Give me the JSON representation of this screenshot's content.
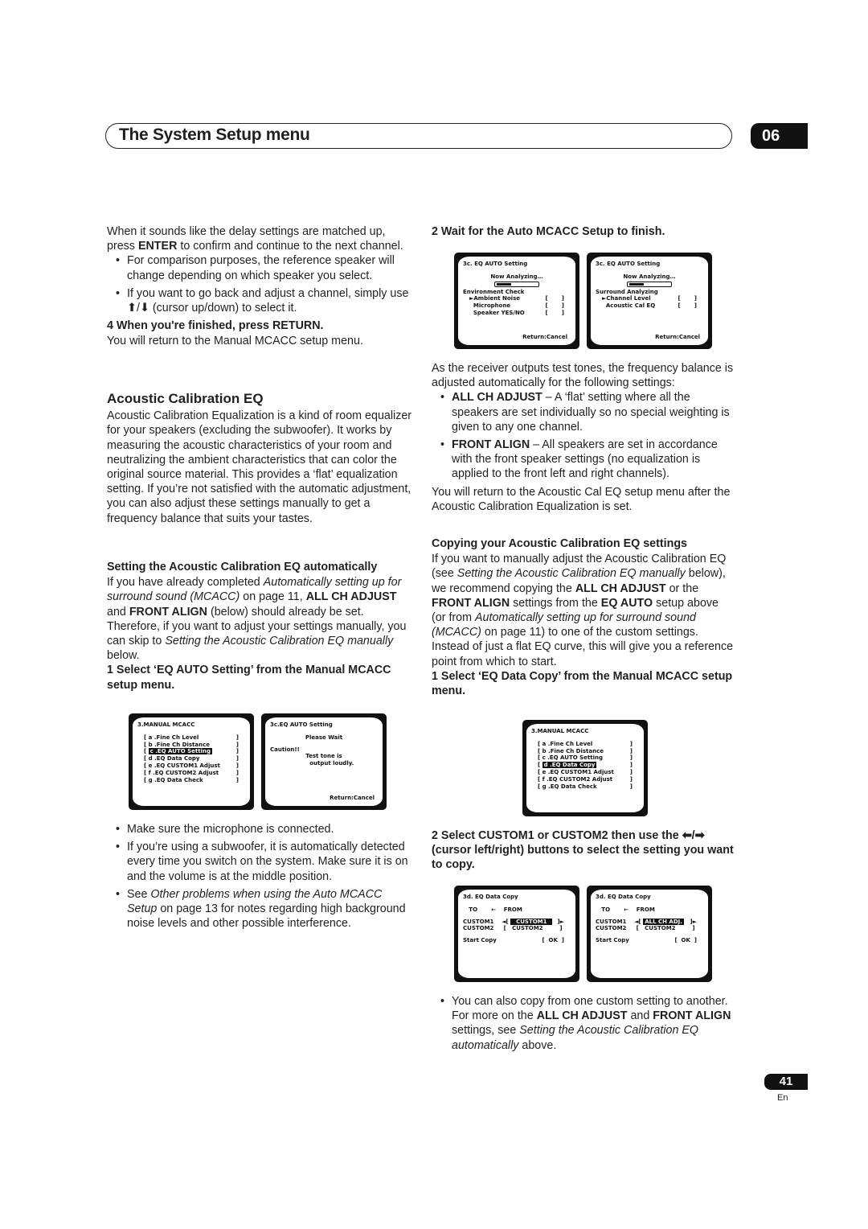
{
  "header": {
    "title": "The System Setup menu",
    "chapter": "06"
  },
  "footer": {
    "page": "41",
    "lang": "En"
  },
  "left": {
    "intro": [
      {
        "type": "p",
        "segs": [
          [
            "When it sounds like the delay settings are matched up, press ",
            ""
          ],
          [
            "ENTER",
            "b"
          ],
          [
            " to confirm and continue to the next channel.",
            ""
          ]
        ]
      },
      {
        "type": "bul",
        "segs": [
          [
            "For comparison purposes, the reference speaker will change depending on which speaker you select.",
            ""
          ]
        ]
      },
      {
        "type": "bul",
        "segs": [
          [
            "If you want to go back and adjust a channel, simply use ⬆/⬇ (cursor up/down) to select it.",
            ""
          ]
        ]
      },
      {
        "type": "step",
        "segs": [
          [
            "4   When you're finished, press RETURN.",
            ""
          ]
        ]
      },
      {
        "type": "p",
        "segs": [
          [
            "You will return to the Manual MCACC setup menu.",
            ""
          ]
        ]
      }
    ],
    "section": [
      {
        "type": "h2",
        "segs": [
          [
            "Acoustic Calibration EQ",
            ""
          ]
        ]
      },
      {
        "type": "p",
        "segs": [
          [
            "Acoustic Calibration Equalization is a kind of room equalizer for your speakers (excluding the subwoofer). It works by measuring the acoustic characteristics of your room and neutralizing the ambient characteristics that can color the original source material. This provides a ‘flat’ equalization setting. If you’re not satisfied with the automatic adjustment, you can also adjust these settings manually to get a frequency balance that suits your tastes.",
            ""
          ]
        ]
      }
    ],
    "auto": [
      {
        "type": "h3",
        "segs": [
          [
            "Setting the Acoustic Calibration EQ automatically",
            ""
          ]
        ]
      },
      {
        "type": "p",
        "segs": [
          [
            "If you have already completed ",
            ""
          ],
          [
            "Automatically setting up for surround sound (MCACC)",
            "i"
          ],
          [
            " on page 11, ",
            ""
          ],
          [
            "ALL CH ADJUST",
            "b"
          ],
          [
            " and ",
            ""
          ],
          [
            "FRONT ALIGN",
            "b"
          ],
          [
            " (below) should already be set. Therefore, if you want to adjust your settings manually, you can skip to ",
            ""
          ],
          [
            "Setting the Acoustic Calibration EQ manually",
            "i"
          ],
          [
            " below.",
            ""
          ]
        ]
      },
      {
        "type": "step",
        "segs": [
          [
            "1   Select ‘EQ AUTO Setting’ from the Manual MCACC setup menu.",
            ""
          ]
        ]
      }
    ],
    "after": [
      {
        "type": "bul",
        "segs": [
          [
            "Make sure the microphone is connected.",
            ""
          ]
        ]
      },
      {
        "type": "bul",
        "segs": [
          [
            "If you’re using a subwoofer, it is automatically detected every time you switch on the system. Make sure it is on and the volume is at the middle position.",
            ""
          ]
        ]
      },
      {
        "type": "bul",
        "segs": [
          [
            "See ",
            ""
          ],
          [
            "Other problems when using the Auto MCACC Setup",
            "i"
          ],
          [
            " on page 13 for notes regarding high background noise levels and other possible interference.",
            ""
          ]
        ]
      }
    ]
  },
  "right": {
    "wait": [
      {
        "type": "step",
        "segs": [
          [
            "2   Wait for the Auto MCACC Setup to finish.",
            ""
          ]
        ]
      }
    ],
    "settings": [
      {
        "type": "p",
        "segs": [
          [
            "As the receiver outputs test tones, the frequency balance is adjusted automatically for the following settings:",
            ""
          ]
        ]
      },
      {
        "type": "bul",
        "segs": [
          [
            "ALL CH ADJUST",
            "b"
          ],
          [
            " – A ‘flat’ setting where all the speakers are set individually so no special weighting is given to any one channel.",
            ""
          ]
        ]
      },
      {
        "type": "bul",
        "segs": [
          [
            "FRONT ALIGN",
            "b"
          ],
          [
            " – All speakers are set in accordance with the front speaker settings (no equalization is applied to the front left and right channels).",
            ""
          ]
        ]
      },
      {
        "type": "p",
        "segs": [
          [
            "You will return to the Acoustic Cal EQ setup menu after the Acoustic Calibration Equalization is set.",
            ""
          ]
        ]
      }
    ],
    "copy": [
      {
        "type": "h3",
        "segs": [
          [
            "Copying your Acoustic Calibration EQ settings",
            ""
          ]
        ]
      },
      {
        "type": "p",
        "segs": [
          [
            "If you want to manually adjust the Acoustic Calibration EQ (see ",
            ""
          ],
          [
            "Setting the Acoustic Calibration EQ manually",
            "i"
          ],
          [
            " below), we recommend copying the ",
            ""
          ],
          [
            "ALL CH ADJUST",
            "b"
          ],
          [
            " or the ",
            ""
          ],
          [
            "FRONT ALIGN",
            "b"
          ],
          [
            " settings from the ",
            ""
          ],
          [
            "EQ AUTO",
            "b"
          ],
          [
            " setup above (or from ",
            ""
          ],
          [
            "Automatically setting up for surround sound (MCACC)",
            "i"
          ],
          [
            " on page 11) to one of the custom settings. Instead of just a flat EQ curve, this will give you a reference point from which to start.",
            ""
          ]
        ]
      },
      {
        "type": "step",
        "segs": [
          [
            "1   Select ‘EQ Data Copy’ from the Manual MCACC setup menu.",
            ""
          ]
        ]
      }
    ],
    "select": [
      {
        "type": "step",
        "segs": [
          [
            "2   Select CUSTOM1 or CUSTOM2 then use the ⬅/➡ (cursor left/right) buttons to select the setting you want to copy.",
            ""
          ]
        ]
      }
    ],
    "last": [
      {
        "type": "bul",
        "segs": [
          [
            "You can also copy from one custom setting to another. For more on the ",
            ""
          ],
          [
            "ALL CH ADJUST",
            "b"
          ],
          [
            " and ",
            ""
          ],
          [
            "FRONT ALIGN",
            "b"
          ],
          [
            " settings, see ",
            ""
          ],
          [
            "Setting the Acoustic Calibration EQ automatically",
            "i"
          ],
          [
            " above.",
            ""
          ]
        ]
      }
    ]
  },
  "screens": {
    "manual_c": [
      {
        "k": "title",
        "t": "3.MANUAL MCACC"
      },
      {
        "k": "item",
        "t": "[ a .Fine Ch Level",
        "r": "]"
      },
      {
        "k": "item",
        "t": "[ b .Fine Ch Distance",
        "r": "]"
      },
      {
        "k": "item",
        "t": "[ ",
        "h": "c .EQ AUTO Setting",
        "r": "]"
      },
      {
        "k": "item",
        "t": "[ d .EQ Data Copy",
        "r": "]"
      },
      {
        "k": "item",
        "t": "[ e .EQ CUSTOM1 Adjust",
        "r": "]"
      },
      {
        "k": "item",
        "t": "[ f .EQ CUSTOM2 Adjust",
        "r": "]"
      },
      {
        "k": "item",
        "t": "[ g .EQ Data Check",
        "r": "]"
      }
    ],
    "wait": [
      {
        "k": "title",
        "t": "3c.EQ AUTO Setting"
      },
      {
        "k": "center gap",
        "t": "Please Wait"
      },
      {
        "k": "gap",
        "t": "Caution!!"
      },
      {
        "k": "center",
        "t": "Test tone is"
      },
      {
        "k": "center",
        "t": "        output loudly."
      },
      {
        "k": "footer",
        "t": "Return:Cancel"
      }
    ],
    "env": [
      {
        "k": "title",
        "t": "3c. EQ AUTO Setting"
      },
      {
        "k": "center",
        "t": "Now Analyzing…"
      },
      {
        "k": "bar",
        "p": 0.35
      },
      {
        "k": "",
        "t": "Environment Check"
      },
      {
        "k": "item",
        "t": "►Ambient Noise",
        "r": "[       ]"
      },
      {
        "k": "item",
        "t": "  Microphone",
        "r": "[       ]"
      },
      {
        "k": "item",
        "t": "  Speaker YES/NO",
        "r": "[       ]"
      },
      {
        "k": "footer",
        "t": "Return:Cancel"
      }
    ],
    "surround": [
      {
        "k": "title",
        "t": "3c. EQ AUTO Setting"
      },
      {
        "k": "center",
        "t": "Now Analyzing…"
      },
      {
        "k": "bar",
        "p": 0.35
      },
      {
        "k": "",
        "t": "Surround Analyzing"
      },
      {
        "k": "item",
        "t": "►Channel Level",
        "r": "[       ]"
      },
      {
        "k": "item",
        "t": "  Acoustic Cal EQ",
        "r": "[       ]"
      },
      {
        "k": "footer",
        "t": "Return:Cancel"
      }
    ],
    "manual_d": [
      {
        "k": "title",
        "t": "3.MANUAL MCACC"
      },
      {
        "k": "item",
        "t": "[ a .Fine Ch Level",
        "r": "]"
      },
      {
        "k": "item",
        "t": "[ b .Fine Ch Distance",
        "r": "]"
      },
      {
        "k": "item",
        "t": "[ c .EQ AUTO Setting",
        "r": "]"
      },
      {
        "k": "item",
        "t": "[ ",
        "h": "d .EQ Data Copy",
        "r": "]"
      },
      {
        "k": "item",
        "t": "[ e .EQ CUSTOM1 Adjust",
        "r": "]"
      },
      {
        "k": "item",
        "t": "[ f .EQ CUSTOM2 Adjust",
        "r": "]"
      },
      {
        "k": "item",
        "t": "[ g .EQ Data Check",
        "r": "]"
      }
    ],
    "copy1": [
      {
        "k": "title",
        "t": "3d. EQ Data Copy"
      },
      {
        "k": "",
        "t": "   TO       ←    FROM"
      },
      {
        "k": "gap",
        "t": "CUSTOM1    ◄[ ",
        "h": "  CUSTOM1  ",
        "r": "]►"
      },
      {
        "k": "",
        "t": "CUSTOM2     [   CUSTOM2  ",
        "r": "] "
      },
      {
        "k": "gap",
        "t": "Start Copy",
        "r": "[  OK  ]"
      }
    ],
    "copy2": [
      {
        "k": "title",
        "t": "3d. EQ Data Copy"
      },
      {
        "k": "",
        "t": "   TO       ←    FROM"
      },
      {
        "k": "gap",
        "t": "CUSTOM1    ◄[ ",
        "h": "ALL CH ADJ.",
        "r": "]►"
      },
      {
        "k": "",
        "t": "CUSTOM2     [   CUSTOM2  ",
        "r": "] "
      },
      {
        "k": "gap",
        "t": "Start Copy",
        "r": "[  OK  ]"
      }
    ]
  }
}
